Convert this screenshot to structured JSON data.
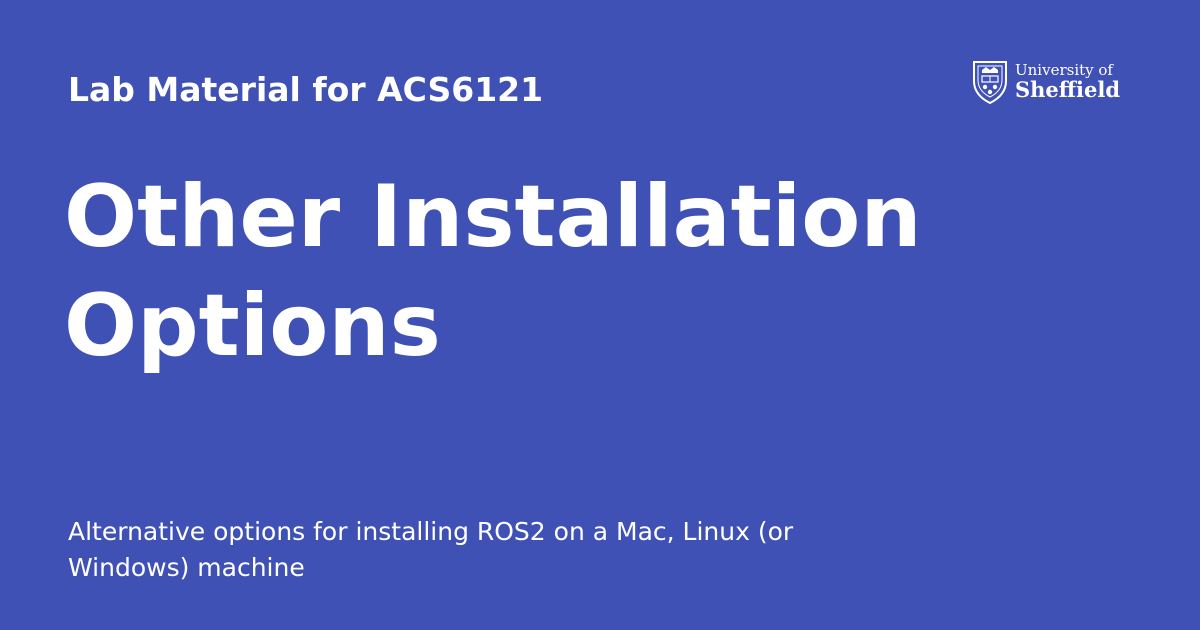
{
  "card": {
    "site_title": "Lab Material for ACS6121",
    "page_title": "Other Installation Options",
    "description": "Alternative options for installing ROS2 on a Mac, Linux (or Windows) machine"
  },
  "logo": {
    "icon": "university-crest-icon",
    "line1": "University of",
    "line2": "Sheffield"
  },
  "colors": {
    "background": "#3f51b5",
    "text": "#ffffff"
  }
}
